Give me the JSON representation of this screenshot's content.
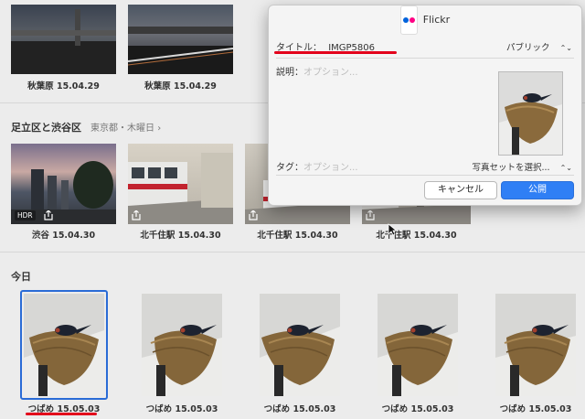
{
  "top_row": [
    {
      "caption": "秋葉原 15.04.29"
    },
    {
      "caption": "秋葉原 15.04.29"
    }
  ],
  "moment2": {
    "title": "足立区と渋谷区",
    "subtitle": "東京都・木曜日",
    "chevron": "›",
    "items": [
      {
        "caption": "渋谷 15.04.30",
        "badge": "HDR"
      },
      {
        "caption": "北千住駅 15.04.30"
      },
      {
        "caption": "北千住駅 15.04.30"
      },
      {
        "caption": "北千住駅 15.04.30"
      }
    ]
  },
  "today": {
    "title": "今日",
    "items": [
      {
        "caption": "つばめ 15.05.03",
        "selected": true
      },
      {
        "caption": "つばめ 15.05.03"
      },
      {
        "caption": "つばめ 15.05.03"
      },
      {
        "caption": "つばめ 15.05.03"
      },
      {
        "caption": "つばめ 15.05.03"
      }
    ]
  },
  "dialog": {
    "app_name": "Flickr",
    "title_label": "タイトル：",
    "title_value": "IMGP5806",
    "privacy": "パブリック",
    "description_label": "説明：",
    "description_placeholder": "オプション...",
    "tags_label": "タグ：",
    "tags_placeholder": "オプション...",
    "photoset": "写真セットを選択...",
    "cancel_label": "キャンセル",
    "publish_label": "公開"
  },
  "colors": {
    "accent_blue": "#2f7ff5",
    "selection_border": "#2a6bd6",
    "annotation_red": "#e3001b",
    "flickr_blue": "#0063dc",
    "flickr_pink": "#ff0084"
  }
}
